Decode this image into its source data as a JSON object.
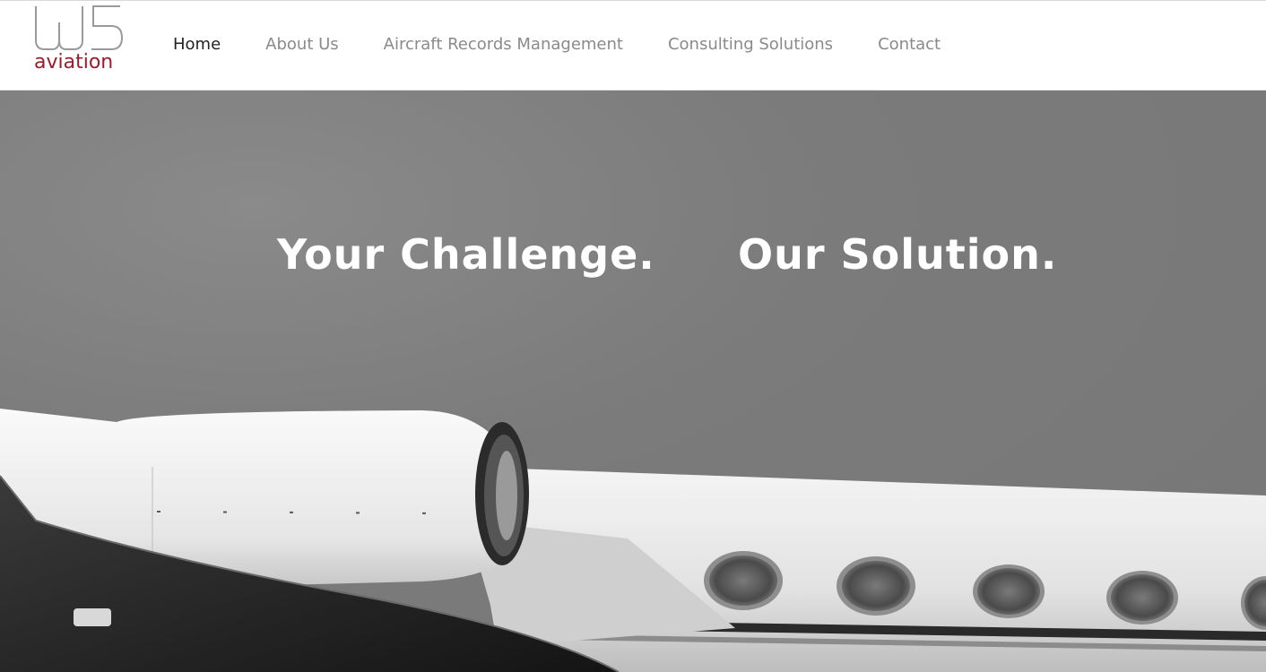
{
  "brand": {
    "mark": "W5",
    "word": "aviation",
    "colors": {
      "accent": "#9b1c2c",
      "mark": "#9a9a9a"
    }
  },
  "nav": {
    "items": [
      {
        "label": "Home",
        "active": true
      },
      {
        "label": "About Us",
        "active": false
      },
      {
        "label": "Aircraft Records Management",
        "active": false
      },
      {
        "label": "Consulting Solutions",
        "active": false
      },
      {
        "label": "Contact",
        "active": false
      }
    ]
  },
  "hero": {
    "headline_left": "Your Challenge.",
    "headline_right": "Our Solution.",
    "image": "private-jet-engine-and-fuselage-black-and-white"
  }
}
